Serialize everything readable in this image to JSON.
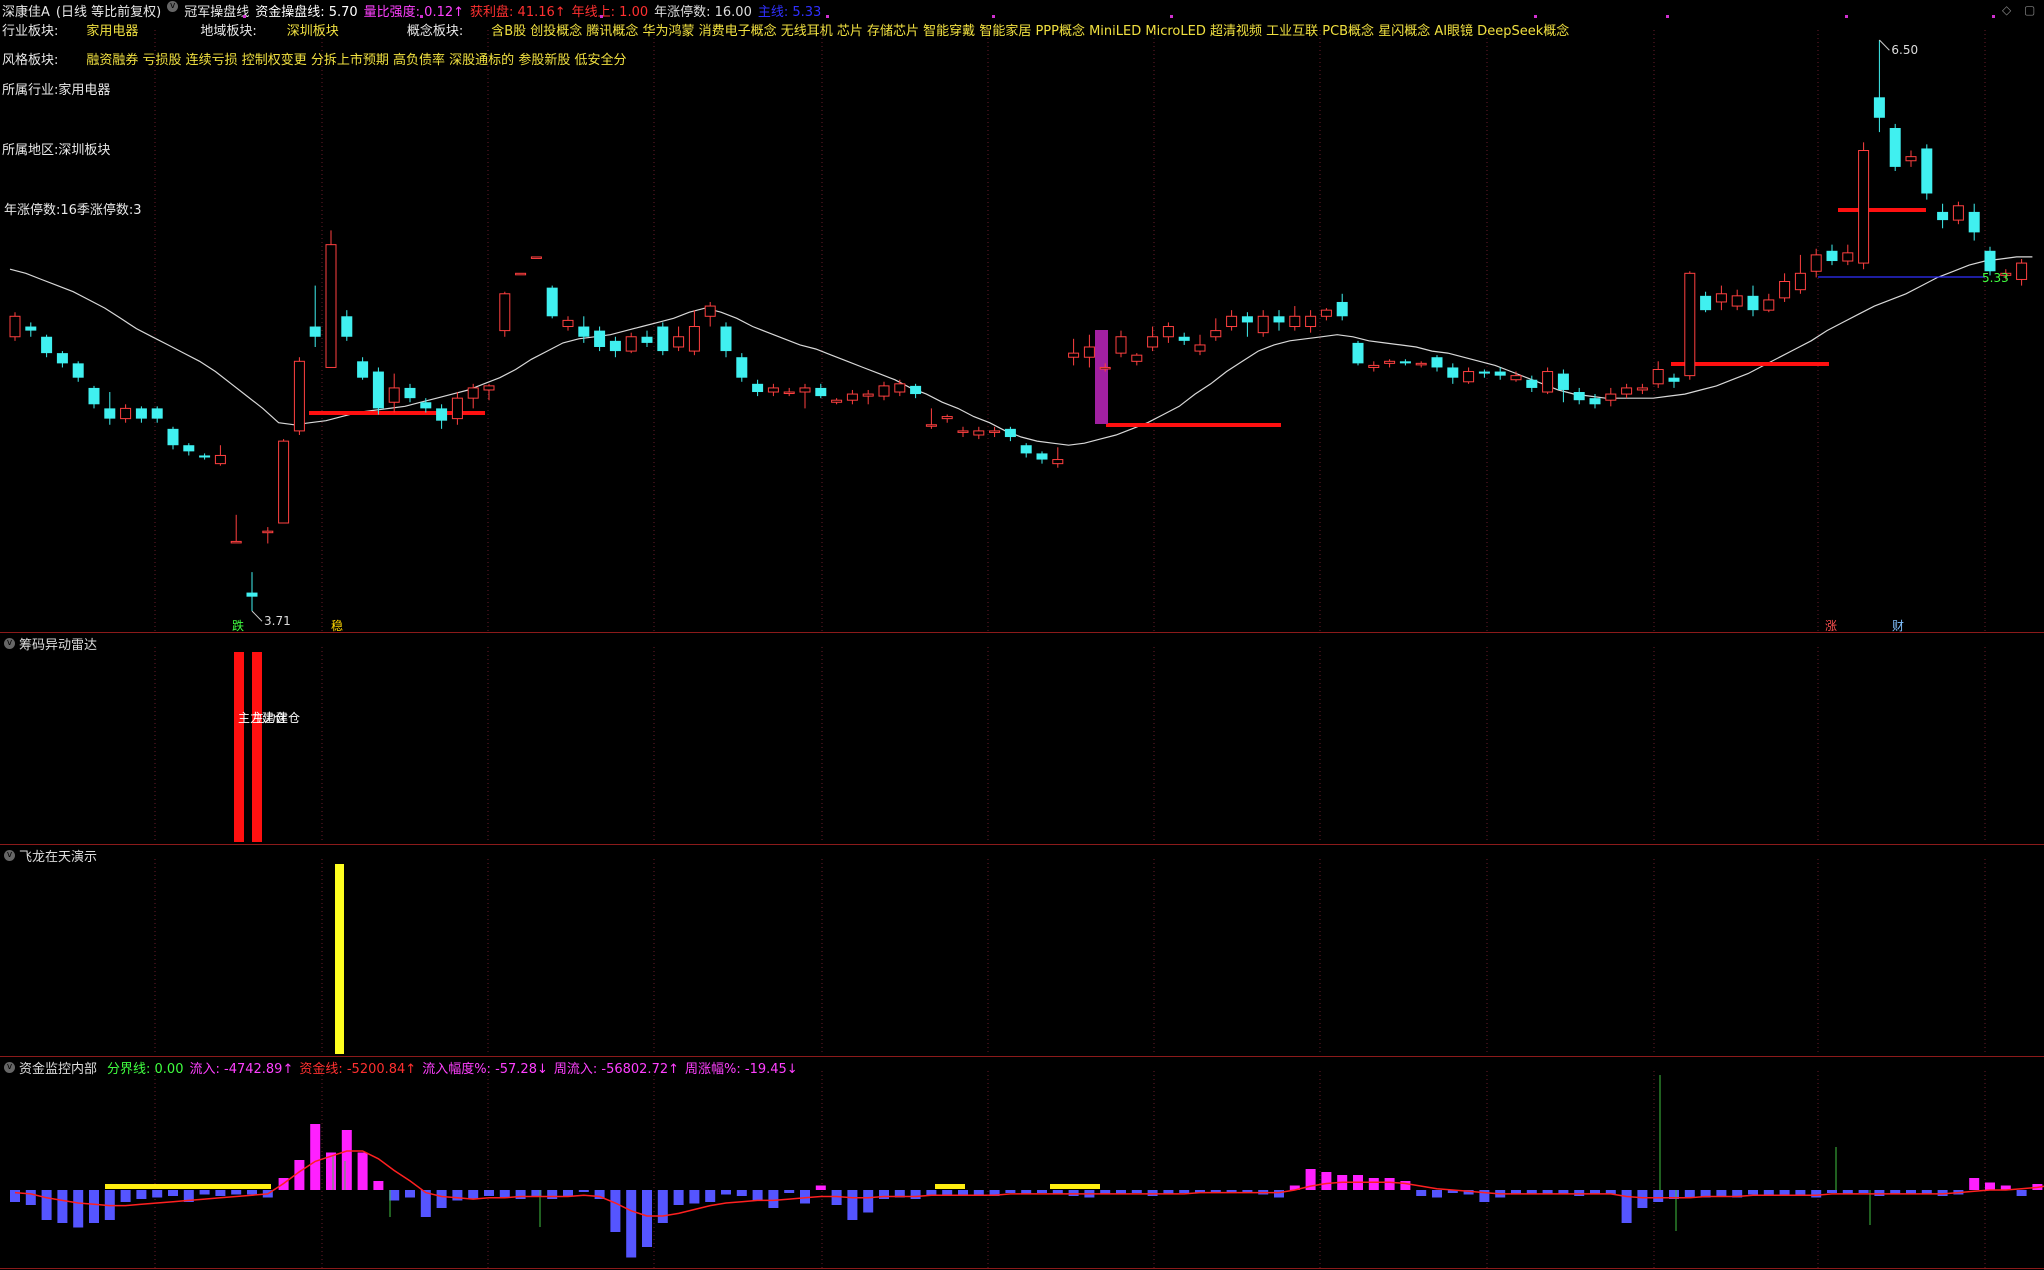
{
  "header": {
    "stock": "深康佳A",
    "period": "(日线 等比前复权)",
    "indicator": "冠军操盘线",
    "items": [
      {
        "label": "资金操盘线:",
        "value": "5.70",
        "color": "#ffffff"
      },
      {
        "label": "量比强度:",
        "value": "0.12↑",
        "color": "#ff40ff"
      },
      {
        "label": "获利盘:",
        "value": "41.16↑",
        "color": "#ff3030"
      },
      {
        "label": "年线上:",
        "value": "1.00",
        "color": "#ff3030"
      },
      {
        "label": "年涨停数:",
        "value": "16.00",
        "color": "#dddddd"
      },
      {
        "label": "主线:",
        "value": "5.33",
        "color": "#3030ff"
      }
    ]
  },
  "info": {
    "industry_block_label": "行业板块:",
    "industry_block": "家用电器",
    "region_block_label": "地域板块:",
    "region_block": "深圳板块",
    "concept_block_label": "概念板块:",
    "concepts": "含B股 创投概念 腾讯概念 华为鸿蒙 消费电子概念 无线耳机 芯片 存储芯片 智能穿戴 智能家居 PPP概念 MiniLED MicroLED 超清视频 工业互联 PCB概念 星闪概念 AI眼镜 DeepSeek概念",
    "style_block_label": "风格板块:",
    "styles": "融资融券 亏损股 连续亏损 控制权变更 分拆上市预期 高负债率 深股通标的 参股新股 低安全分",
    "industry": "所属行业:家用电器",
    "region": "所属地区:深圳板块",
    "limitup": "年涨停数:16季涨停数:3"
  },
  "annotations": {
    "high": "6.50",
    "low": "3.71",
    "last": "5.33",
    "flag_die": "跌",
    "flag_wen": "稳",
    "flag_zhang": "涨",
    "flag_cai": "财"
  },
  "sub1": {
    "title": "筹码异动雷达",
    "label": "主力建仓"
  },
  "sub2": {
    "title": "飞龙在天演示"
  },
  "sub3": {
    "title": "资金监控内部",
    "items": [
      {
        "label": "分界线:",
        "value": "0.00",
        "color": "#40ff40"
      },
      {
        "label": "流入:",
        "value": "-4742.89↑",
        "color": "#ff40ff"
      },
      {
        "label": "资金线:",
        "value": "-5200.84↑",
        "color": "#ff3030"
      },
      {
        "label": "流入幅度%:",
        "value": "-57.28↓",
        "color": "#ff40ff"
      },
      {
        "label": "周流入:",
        "value": "-56802.72↑",
        "color": "#ff40ff"
      },
      {
        "label": "周涨幅%:",
        "value": "-19.45↓",
        "color": "#ff40ff"
      }
    ]
  },
  "chart_data": [
    {
      "type": "candlestick",
      "candles": [
        [
          5.05,
          5.15,
          5.17,
          5.03
        ],
        [
          5.1,
          5.08,
          5.12,
          5.05
        ],
        [
          5.05,
          4.97,
          5.06,
          4.95
        ],
        [
          4.97,
          4.92,
          4.98,
          4.9
        ],
        [
          4.92,
          4.85,
          4.93,
          4.83
        ],
        [
          4.8,
          4.72,
          4.81,
          4.7
        ],
        [
          4.7,
          4.65,
          4.78,
          4.62
        ],
        [
          4.65,
          4.7,
          4.72,
          4.63
        ],
        [
          4.7,
          4.65,
          4.71,
          4.63
        ],
        [
          4.7,
          4.65,
          4.71,
          4.63
        ],
        [
          4.6,
          4.52,
          4.61,
          4.5
        ],
        [
          4.52,
          4.49,
          4.53,
          4.47
        ],
        [
          4.47,
          4.46,
          4.48,
          4.45
        ],
        [
          4.43,
          4.47,
          4.52,
          4.42
        ],
        [
          4.05,
          4.05,
          4.18,
          4.05
        ],
        [
          3.8,
          3.78,
          3.9,
          3.71
        ],
        [
          4.1,
          4.1,
          4.12,
          4.04
        ],
        [
          4.14,
          4.54,
          4.55,
          4.14
        ],
        [
          4.59,
          4.93,
          4.95,
          4.57
        ],
        [
          5.1,
          5.05,
          5.3,
          5.0
        ],
        [
          4.9,
          5.5,
          5.57,
          4.9
        ],
        [
          5.15,
          5.05,
          5.18,
          5.03
        ],
        [
          4.93,
          4.85,
          4.95,
          4.84
        ],
        [
          4.88,
          4.7,
          4.9,
          4.67
        ],
        [
          4.73,
          4.8,
          4.87,
          4.68
        ],
        [
          4.8,
          4.75,
          4.82,
          4.73
        ],
        [
          4.73,
          4.7,
          4.75,
          4.68
        ],
        [
          4.7,
          4.64,
          4.72,
          4.6
        ],
        [
          4.65,
          4.75,
          4.78,
          4.62
        ],
        [
          4.75,
          4.8,
          4.82,
          4.7
        ],
        [
          4.79,
          4.81,
          4.82,
          4.74
        ],
        [
          5.08,
          5.26,
          5.27,
          5.05
        ],
        [
          5.36,
          5.36,
          5.36,
          5.36
        ],
        [
          5.44,
          5.44,
          5.44,
          5.44
        ],
        [
          5.29,
          5.15,
          5.3,
          5.14
        ],
        [
          5.1,
          5.13,
          5.15,
          5.08
        ],
        [
          5.1,
          5.05,
          5.15,
          5.02
        ],
        [
          5.08,
          5.0,
          5.1,
          4.98
        ],
        [
          5.03,
          4.98,
          5.05,
          4.95
        ],
        [
          4.98,
          5.05,
          5.07,
          4.97
        ],
        [
          5.05,
          5.02,
          5.08,
          5.0
        ],
        [
          5.1,
          4.98,
          5.12,
          4.96
        ],
        [
          5.0,
          5.05,
          5.1,
          4.98
        ],
        [
          4.98,
          5.1,
          5.18,
          4.96
        ],
        [
          5.15,
          5.2,
          5.22,
          5.1
        ],
        [
          5.1,
          4.98,
          5.12,
          4.95
        ],
        [
          4.95,
          4.85,
          4.97,
          4.83
        ],
        [
          4.82,
          4.78,
          4.84,
          4.76
        ],
        [
          4.78,
          4.8,
          4.82,
          4.76
        ],
        [
          4.78,
          4.78,
          4.8,
          4.76
        ],
        [
          4.78,
          4.8,
          4.82,
          4.7
        ],
        [
          4.8,
          4.76,
          4.82,
          4.75
        ],
        [
          4.73,
          4.74,
          4.75,
          4.72
        ],
        [
          4.74,
          4.77,
          4.79,
          4.72
        ],
        [
          4.76,
          4.77,
          4.79,
          4.72
        ],
        [
          4.76,
          4.81,
          4.83,
          4.74
        ],
        [
          4.78,
          4.82,
          4.84,
          4.76
        ],
        [
          4.81,
          4.77,
          4.82,
          4.75
        ],
        [
          4.62,
          4.62,
          4.7,
          4.6
        ],
        [
          4.65,
          4.66,
          4.67,
          4.63
        ],
        [
          4.59,
          4.59,
          4.61,
          4.56
        ],
        [
          4.57,
          4.59,
          4.61,
          4.55
        ],
        [
          4.59,
          4.59,
          4.61,
          4.56
        ],
        [
          4.6,
          4.56,
          4.61,
          4.54
        ],
        [
          4.52,
          4.48,
          4.53,
          4.46
        ],
        [
          4.48,
          4.45,
          4.49,
          4.43
        ],
        [
          4.43,
          4.45,
          4.51,
          4.41
        ],
        [
          4.95,
          4.97,
          5.04,
          4.91
        ],
        [
          4.95,
          5.0,
          5.06,
          4.9
        ],
        [
          4.9,
          4.9,
          4.92,
          4.88
        ],
        [
          4.97,
          5.05,
          5.08,
          4.95
        ],
        [
          4.93,
          4.96,
          4.97,
          4.91
        ],
        [
          5.0,
          5.05,
          5.1,
          4.98
        ],
        [
          5.05,
          5.1,
          5.12,
          5.02
        ],
        [
          5.05,
          5.03,
          5.07,
          5.01
        ],
        [
          4.98,
          5.01,
          5.06,
          4.96
        ],
        [
          5.05,
          5.08,
          5.14,
          5.03
        ],
        [
          5.1,
          5.15,
          5.18,
          5.08
        ],
        [
          5.15,
          5.12,
          5.17,
          5.05
        ],
        [
          5.07,
          5.15,
          5.18,
          5.05
        ],
        [
          5.15,
          5.12,
          5.18,
          5.08
        ],
        [
          5.1,
          5.15,
          5.2,
          5.08
        ],
        [
          5.1,
          5.15,
          5.18,
          5.07
        ],
        [
          5.15,
          5.18,
          5.19,
          5.13
        ],
        [
          5.22,
          5.15,
          5.26,
          5.13
        ],
        [
          5.02,
          4.92,
          5.03,
          4.91
        ],
        [
          4.9,
          4.91,
          4.93,
          4.88
        ],
        [
          4.92,
          4.93,
          4.94,
          4.9
        ],
        [
          4.93,
          4.92,
          4.94,
          4.91
        ],
        [
          4.92,
          4.92,
          4.93,
          4.9
        ],
        [
          4.95,
          4.9,
          4.96,
          4.88
        ],
        [
          4.9,
          4.85,
          4.92,
          4.82
        ],
        [
          4.83,
          4.88,
          4.9,
          4.82
        ],
        [
          4.88,
          4.87,
          4.89,
          4.85
        ],
        [
          4.88,
          4.86,
          4.9,
          4.84
        ],
        [
          4.84,
          4.86,
          4.88,
          4.83
        ],
        [
          4.84,
          4.8,
          4.86,
          4.78
        ],
        [
          4.78,
          4.88,
          4.9,
          4.77
        ],
        [
          4.87,
          4.79,
          4.89,
          4.73
        ],
        [
          4.78,
          4.74,
          4.8,
          4.72
        ],
        [
          4.75,
          4.72,
          4.77,
          4.7
        ],
        [
          4.74,
          4.77,
          4.8,
          4.71
        ],
        [
          4.77,
          4.8,
          4.82,
          4.75
        ],
        [
          4.79,
          4.8,
          4.82,
          4.77
        ],
        [
          4.82,
          4.89,
          4.93,
          4.8
        ],
        [
          4.85,
          4.83,
          4.87,
          4.8
        ],
        [
          4.86,
          5.36,
          5.37,
          4.84
        ],
        [
          5.25,
          5.18,
          5.27,
          5.17
        ],
        [
          5.22,
          5.26,
          5.3,
          5.18
        ],
        [
          5.2,
          5.25,
          5.28,
          5.18
        ],
        [
          5.25,
          5.18,
          5.3,
          5.15
        ],
        [
          5.18,
          5.23,
          5.26,
          5.17
        ],
        [
          5.24,
          5.32,
          5.36,
          5.22
        ],
        [
          5.28,
          5.36,
          5.45,
          5.26
        ],
        [
          5.37,
          5.45,
          5.48,
          5.34
        ],
        [
          5.47,
          5.42,
          5.5,
          5.4
        ],
        [
          5.42,
          5.46,
          5.5,
          5.4
        ],
        [
          5.41,
          5.96,
          6.0,
          5.38
        ],
        [
          6.22,
          6.12,
          6.5,
          6.05
        ],
        [
          6.07,
          5.88,
          6.09,
          5.86
        ],
        [
          5.91,
          5.93,
          5.96,
          5.88
        ],
        [
          5.97,
          5.75,
          5.99,
          5.72
        ],
        [
          5.66,
          5.62,
          5.7,
          5.58
        ],
        [
          5.62,
          5.69,
          5.71,
          5.6
        ],
        [
          5.66,
          5.56,
          5.7,
          5.52
        ],
        [
          5.47,
          5.37,
          5.49,
          5.35
        ],
        [
          5.35,
          5.36,
          5.38,
          5.33
        ],
        [
          5.33,
          5.41,
          5.43,
          5.3
        ]
      ],
      "ma_line": [
        5.38,
        5.36,
        5.33,
        5.3,
        5.27,
        5.23,
        5.19,
        5.14,
        5.09,
        5.05,
        5.01,
        4.97,
        4.93,
        4.88,
        4.82,
        4.76,
        4.7,
        4.63,
        4.62,
        4.63,
        4.64,
        4.66,
        4.68,
        4.69,
        4.7,
        4.71,
        4.73,
        4.75,
        4.77,
        4.79,
        4.82,
        4.85,
        4.89,
        4.94,
        4.98,
        5.02,
        5.04,
        5.05,
        5.06,
        5.08,
        5.1,
        5.12,
        5.14,
        5.17,
        5.19,
        5.17,
        5.14,
        5.1,
        5.07,
        5.04,
        5.01,
        4.99,
        4.96,
        4.93,
        4.9,
        4.87,
        4.84,
        4.8,
        4.77,
        4.73,
        4.7,
        4.66,
        4.63,
        4.59,
        4.56,
        4.54,
        4.53,
        4.52,
        4.53,
        4.55,
        4.57,
        4.6,
        4.63,
        4.67,
        4.71,
        4.77,
        4.82,
        4.88,
        4.93,
        4.98,
        5.01,
        5.03,
        5.04,
        5.05,
        5.06,
        5.05,
        5.03,
        5.02,
        5.01,
        5.0,
        4.98,
        4.97,
        4.95,
        4.93,
        4.91,
        4.88,
        4.85,
        4.82,
        4.79,
        4.77,
        4.76,
        4.75,
        4.75,
        4.75,
        4.75,
        4.76,
        4.77,
        4.79,
        4.81,
        4.84,
        4.87,
        4.91,
        4.95,
        4.99,
        5.03,
        5.08,
        5.12,
        5.16,
        5.2,
        5.23,
        5.26,
        5.3,
        5.34,
        5.37,
        5.4,
        5.42,
        5.43,
        5.44,
        5.44
      ],
      "high_label": "6.50",
      "low_label": "3.71",
      "last_label": "5.33"
    }
  ]
}
